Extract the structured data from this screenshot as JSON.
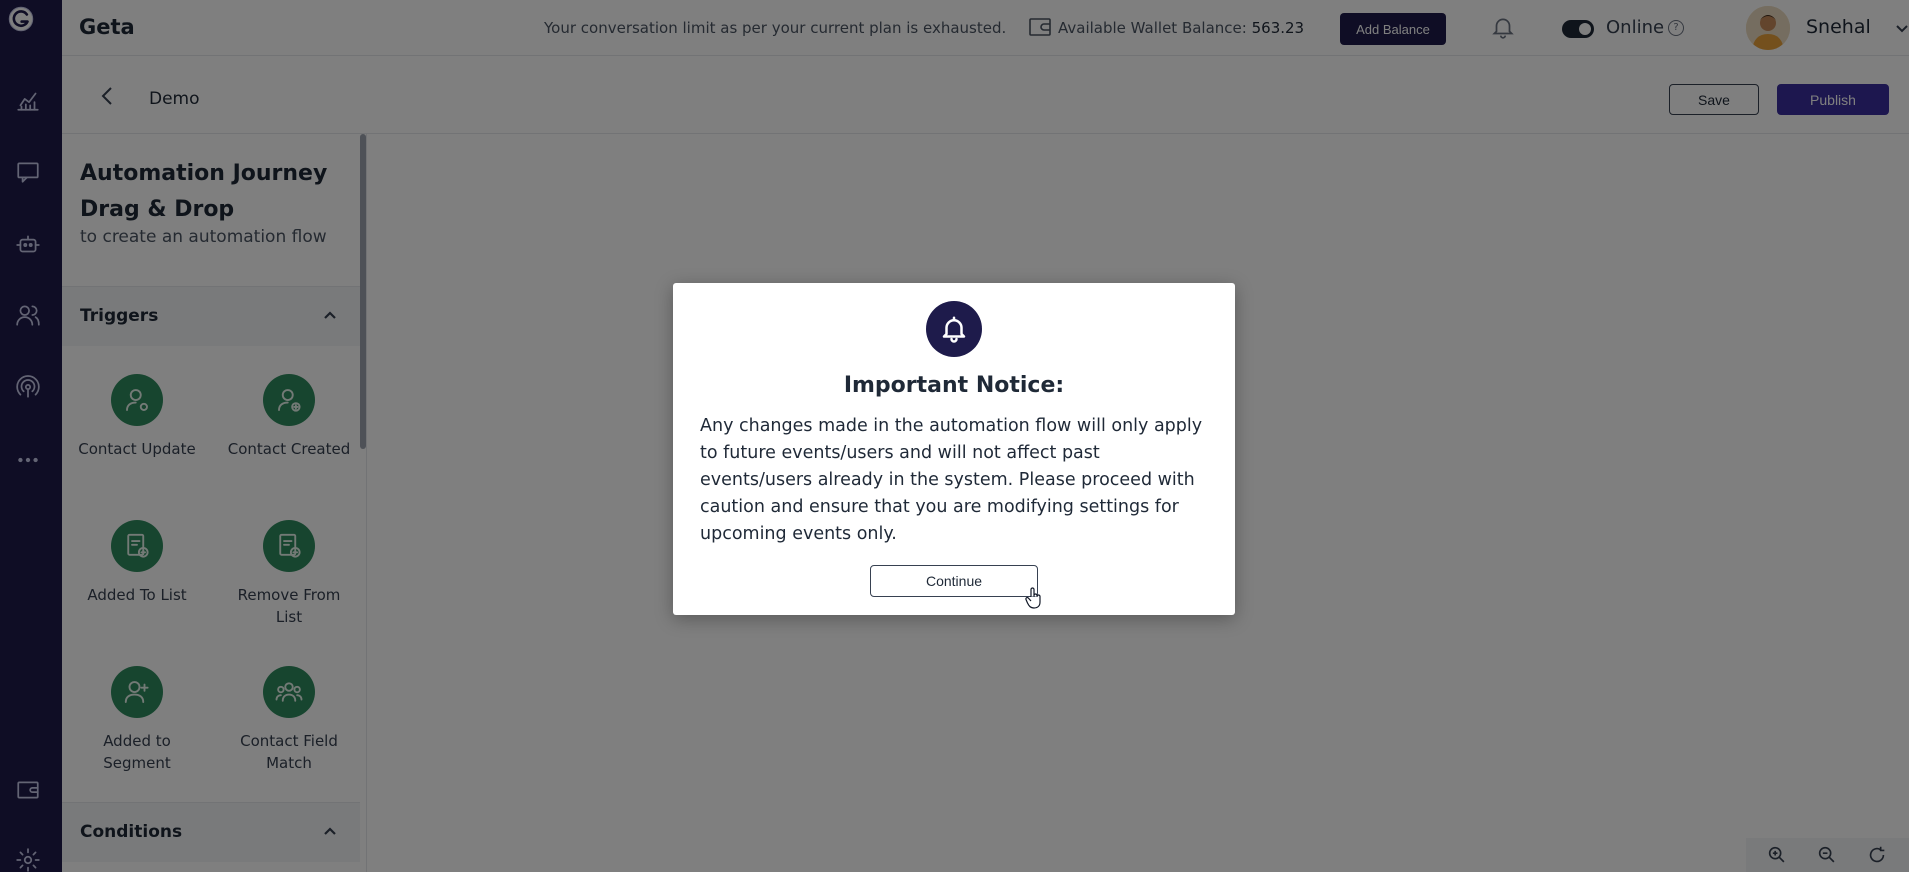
{
  "topbar": {
    "brand": "Geta",
    "limit_message": "Your conversation limit as per your current plan is exhausted.",
    "wallet_label": "Available Wallet Balance:",
    "wallet_value": "563.23",
    "add_balance": "Add Balance",
    "status_label": "Online",
    "help_glyph": "?",
    "user_name": "Snehal"
  },
  "subheader": {
    "flow_name": "Demo",
    "save": "Save",
    "publish": "Publish"
  },
  "panel": {
    "title": "Automation Journey Drag & Drop",
    "subtitle": "to create an automation flow",
    "sections": {
      "triggers": "Triggers",
      "conditions": "Conditions"
    },
    "triggers": [
      {
        "label": "Contact Update",
        "icon": "user-icon"
      },
      {
        "label": "Contact Created",
        "icon": "user-plus-icon"
      },
      {
        "label": "Added To List",
        "icon": "list-add-icon"
      },
      {
        "label": "Remove From List",
        "icon": "list-remove-icon"
      },
      {
        "label": "Added to Segment",
        "icon": "segment-add-icon"
      },
      {
        "label": "Contact Field Match",
        "icon": "group-icon"
      }
    ]
  },
  "modal": {
    "icon": "bell-icon",
    "title": "Important Notice:",
    "body": "Any changes made in the automation flow will only apply to future events/users and will not affect past events/users already in the system. Please proceed with caution and ensure that you are modifying settings for upcoming events only.",
    "continue": "Continue"
  },
  "colors": {
    "rail": "#1e1b4b",
    "trigger_green": "#2f8a5e",
    "publish": "#3b2f9e"
  }
}
